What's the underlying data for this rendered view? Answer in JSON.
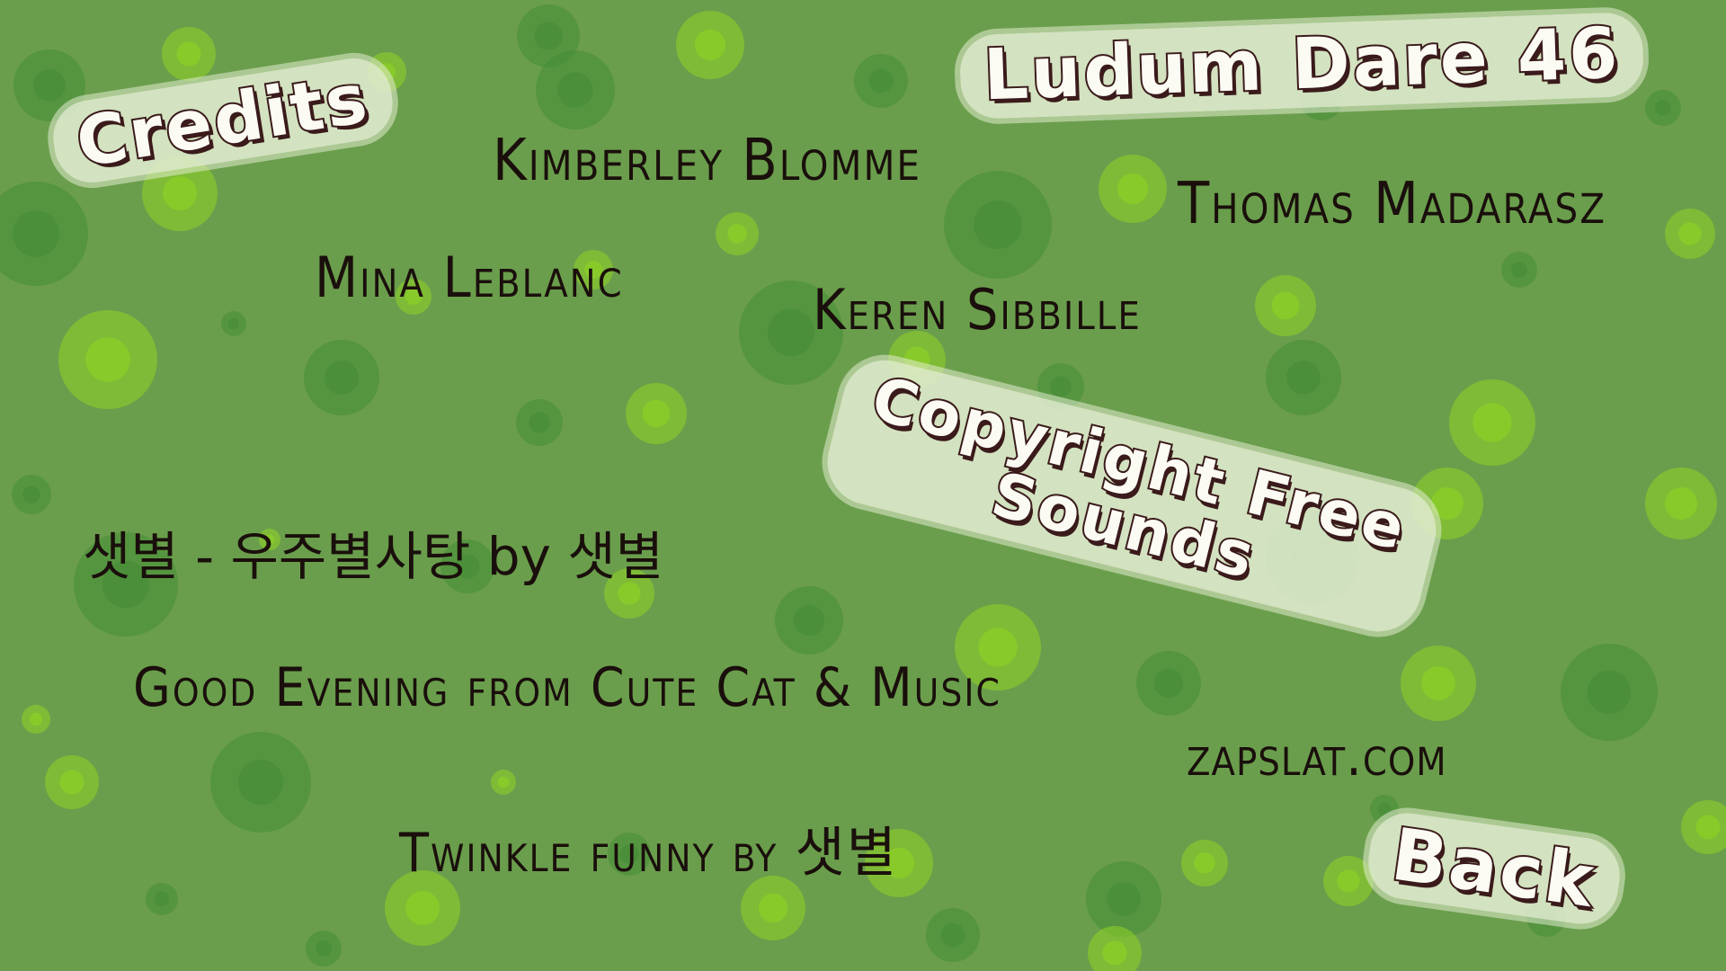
{
  "screen": {
    "credits_title": "Credits",
    "jam_title": "Ludum Dare 46",
    "sounds_title_line1": "Copyright Free",
    "sounds_title_line2": "Sounds",
    "back_label": "Back"
  },
  "team": [
    "Kimberley Blomme",
    "Thomas Madarasz",
    "Mina Leblanc",
    "Keren Sibbille"
  ],
  "music": [
    "샛별 - 우주별사탕 by 샛별",
    "Good Evening from Cute Cat & Music",
    "Twinkle funny by 샛별"
  ],
  "sound_source": "zapslat.com",
  "colors": {
    "background": "#6a9e4c",
    "bubble_dark": "#3f8a33",
    "bubble_light": "#8fd424",
    "sticker_bg": "#e1ecd0",
    "outline": "#3a1a1a"
  }
}
